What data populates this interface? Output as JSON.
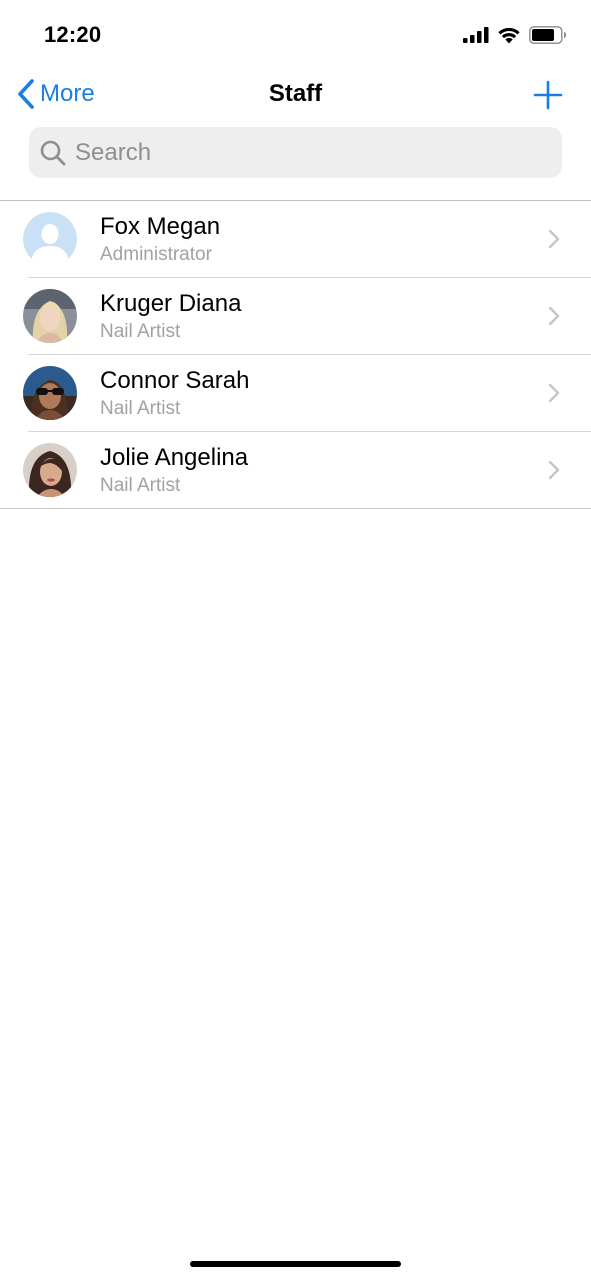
{
  "status_bar": {
    "time": "12:20",
    "icons": [
      "cellular-signal-icon",
      "wifi-icon",
      "battery-icon"
    ]
  },
  "nav": {
    "back_label": "More",
    "title": "Staff",
    "add_icon": "plus-icon",
    "accent_color": "#1a7fe0"
  },
  "search": {
    "placeholder": "Search",
    "value": ""
  },
  "staff": [
    {
      "name": "Fox Megan",
      "role": "Administrator",
      "avatar": "default-avatar"
    },
    {
      "name": "Kruger Diana",
      "role": "Nail Artist",
      "avatar": "photo-avatar"
    },
    {
      "name": "Connor Sarah",
      "role": "Nail Artist",
      "avatar": "photo-avatar"
    },
    {
      "name": "Jolie Angelina",
      "role": "Nail Artist",
      "avatar": "photo-avatar"
    }
  ]
}
